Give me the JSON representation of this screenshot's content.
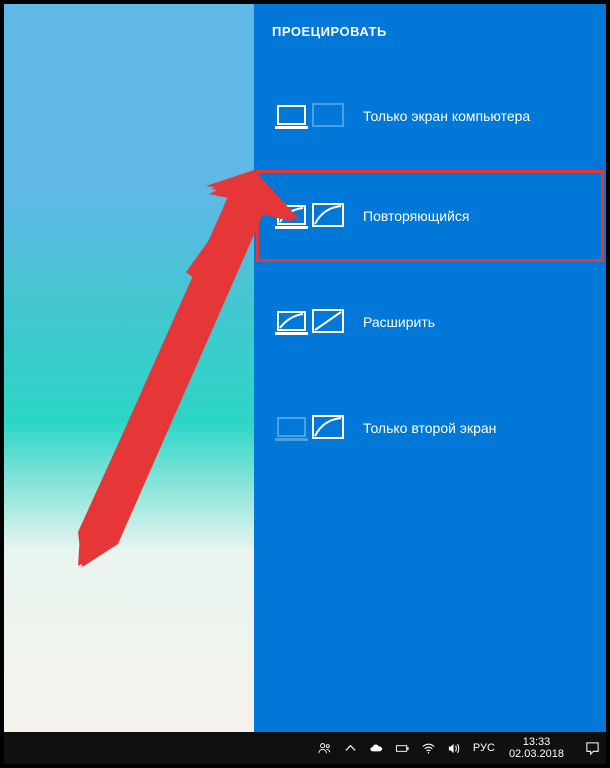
{
  "panel": {
    "title": "ПРОЕЦИРОВАТЬ",
    "options": [
      {
        "label": "Только экран компьютера"
      },
      {
        "label": "Повторяющийся"
      },
      {
        "label": "Расширить"
      },
      {
        "label": "Только второй экран"
      }
    ],
    "highlighted_index": 1
  },
  "taskbar": {
    "language": "РУС",
    "time": "13:33",
    "date": "02.03.2018"
  },
  "annotation": {
    "arrow_color": "#e53737",
    "highlight_color": "#e53737"
  }
}
